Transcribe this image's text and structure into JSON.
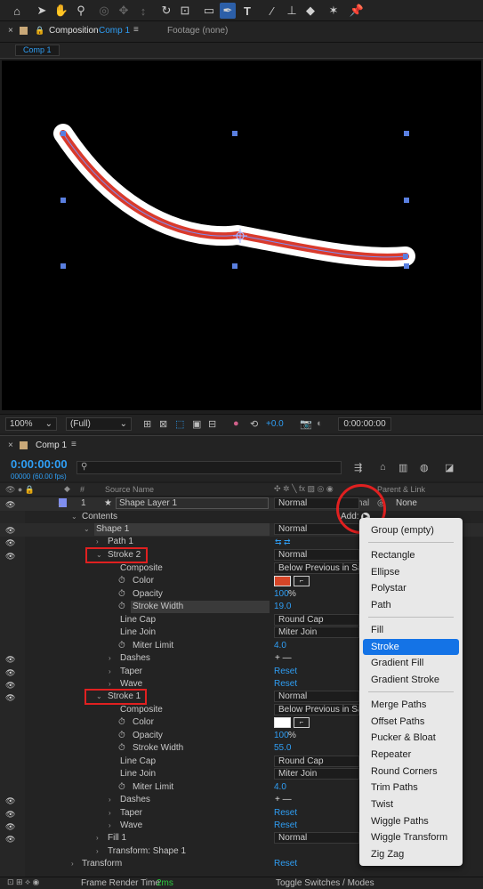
{
  "toolbar": {
    "icons": [
      "home-icon",
      "selection-tool-icon",
      "hand-tool-icon",
      "zoom-tool-icon",
      "orbit-camera-icon",
      "pan-camera-icon",
      "dolly-camera-icon",
      "rotation-tool-icon",
      "pan-behind-icon",
      "rectangle-tool-icon",
      "pen-tool-icon",
      "type-tool-icon",
      "brush-tool-icon",
      "clone-stamp-icon",
      "eraser-tool-icon",
      "roto-brush-icon",
      "puppet-pin-icon"
    ]
  },
  "composition_tab": {
    "close": "×",
    "prefix": "Composition",
    "name": "Comp 1",
    "menu": "≡",
    "footage": "Footage (none)",
    "subtab": "Comp 1"
  },
  "viewer_bar": {
    "zoom": "100%",
    "resolution": "(Full)",
    "exposure": "+0.0",
    "timecode": "0:00:00:00"
  },
  "timeline": {
    "close": "×",
    "title": "Comp 1",
    "menu": "≡",
    "timecode": "0:00:00:00",
    "fps": "00000 (60.00 fps)",
    "search_placeholder": "",
    "col_num": "#",
    "col_source": "Source Name",
    "col_parent": "Parent & Link"
  },
  "rows": [
    {
      "num": "1",
      "label": "Shape Layer 1",
      "mode": "Normal",
      "parent": "None"
    },
    {
      "label": "Contents",
      "add": "Add:"
    },
    {
      "label": "Shape 1",
      "value": "Normal"
    },
    {
      "label": "Path 1"
    },
    {
      "label": "Stroke 2",
      "value": "Normal"
    },
    {
      "label": "Composite",
      "value": "Below Previous in Sa"
    },
    {
      "label": "Color"
    },
    {
      "label": "Opacity",
      "value": "100",
      "unit": "%"
    },
    {
      "label": "Stroke Width",
      "value": "19.0"
    },
    {
      "label": "Line Cap",
      "value": "Round Cap"
    },
    {
      "label": "Line Join",
      "value": "Miter Join"
    },
    {
      "label": "Miter Limit",
      "value": "4.0"
    },
    {
      "label": "Dashes",
      "value": "+ —"
    },
    {
      "label": "Taper",
      "value": "Reset"
    },
    {
      "label": "Wave",
      "value": "Reset"
    },
    {
      "label": "Stroke 1",
      "value": "Normal"
    },
    {
      "label": "Composite",
      "value": "Below Previous in Sa"
    },
    {
      "label": "Color"
    },
    {
      "label": "Opacity",
      "value": "100",
      "unit": "%"
    },
    {
      "label": "Stroke Width",
      "value": "55.0"
    },
    {
      "label": "Line Cap",
      "value": "Round Cap"
    },
    {
      "label": "Line Join",
      "value": "Miter Join"
    },
    {
      "label": "Miter Limit",
      "value": "4.0"
    },
    {
      "label": "Dashes",
      "value": "+ —"
    },
    {
      "label": "Taper",
      "value": "Reset"
    },
    {
      "label": "Wave",
      "value": "Reset"
    },
    {
      "label": "Fill 1",
      "value": "Normal"
    },
    {
      "label": "Transform: Shape 1"
    },
    {
      "label": "Transform",
      "value": "Reset"
    }
  ],
  "add_menu": {
    "items": [
      "Group (empty)",
      "Rectangle",
      "Ellipse",
      "Polystar",
      "Path",
      "Fill",
      "Stroke",
      "Gradient Fill",
      "Gradient Stroke",
      "Merge Paths",
      "Offset Paths",
      "Pucker & Bloat",
      "Repeater",
      "Round Corners",
      "Trim Paths",
      "Twist",
      "Wiggle Paths",
      "Wiggle Transform",
      "Zig Zag"
    ],
    "selected": "Stroke"
  },
  "status": {
    "render_label": "Frame Render Time",
    "render_value": "2ms",
    "toggle": "Toggle Switches / Modes"
  },
  "colors": {
    "stroke2_color": "#d64527",
    "stroke1_color": "#ffffff",
    "accent": "#2f9ef4",
    "highlight": "#1473e6",
    "annotation": "#e02020",
    "layer_label": "#7f8ef0"
  }
}
